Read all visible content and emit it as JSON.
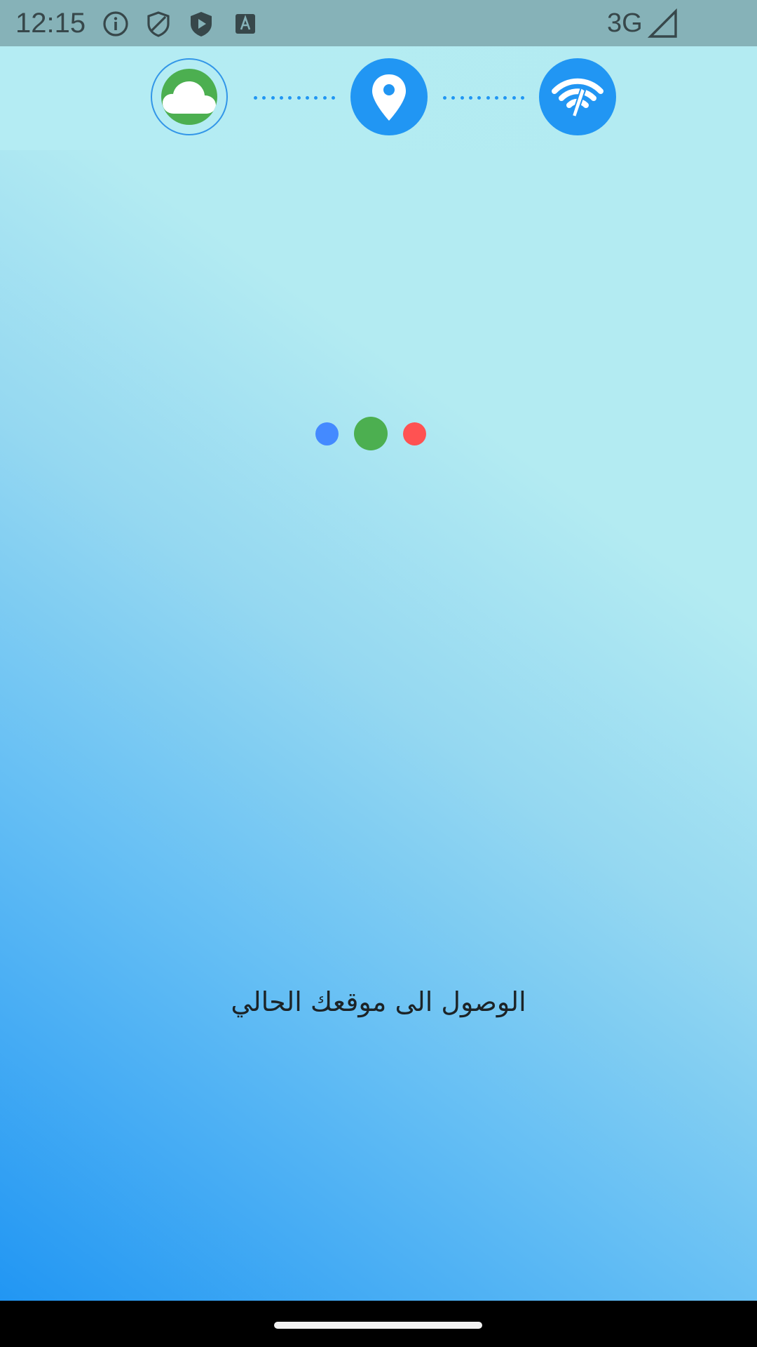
{
  "status_bar": {
    "time": "12:15",
    "network": "3G",
    "icons": [
      "info-icon",
      "shield-outline-icon",
      "shield-play-icon",
      "text-box-icon",
      "signal-icon"
    ]
  },
  "steps": {
    "items": [
      "cloud-icon",
      "location-pin-icon",
      "wifi-speed-icon"
    ],
    "active_color": "#2196f3",
    "weather_color": "#4caf50"
  },
  "loader": {
    "colors": [
      "#448aff",
      "#4caf50",
      "#ff5252"
    ]
  },
  "main": {
    "message": "الوصول الى موقعك الحالي"
  }
}
